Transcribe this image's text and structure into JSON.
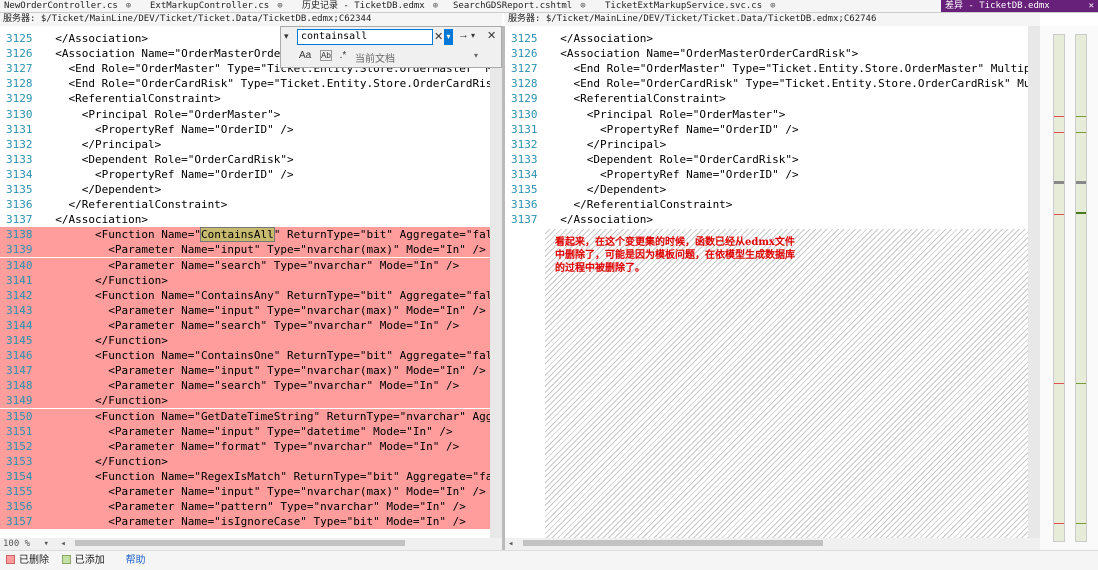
{
  "tabs": [
    {
      "label": "NewOrderController.cs",
      "pin": "⊕"
    },
    {
      "label": "ExtMarkupController.cs",
      "pin": "⊕"
    },
    {
      "label": "历史记录 - TicketDB.edmx",
      "pin": "⊕"
    },
    {
      "label": "SearchGDSReport.cshtml",
      "pin": "⊕"
    },
    {
      "label": "TicketExtMarkupService.svc.cs",
      "pin": "⊕"
    }
  ],
  "active_tab": {
    "label": "差异 - TicketDB.edmx",
    "close": "✕"
  },
  "left_path": "服务器: $/Ticket/MainLine/DEV/Ticket/Ticket.Data/TicketDB.edmx;C62344",
  "right_path": "服务器: $/Ticket/MainLine/DEV/Ticket/Ticket.Data/TicketDB.edmx;C62746",
  "find": {
    "expand": "▾",
    "value": "containsall",
    "clear": "✕",
    "dropdown": "▾",
    "next": "→",
    "next_dropdown": "▾",
    "close": "✕",
    "option_case": "Aa",
    "option_word": "Ab",
    "option_regex": ".*",
    "scope": "当前文档",
    "scope_dropdown": "▾"
  },
  "left_lines": [
    {
      "n": "3125",
      "t": "  </Association>",
      "del": false
    },
    {
      "n": "3126",
      "t": "  <Association Name=\"OrderMasterOrder",
      "del": false
    },
    {
      "n": "3127",
      "t": "    <End Role=\"OrderMaster\" Type=\"Ticket.Entity.Store.OrderMaster\" Multi",
      "del": false
    },
    {
      "n": "3128",
      "t": "    <End Role=\"OrderCardRisk\" Type=\"Ticket.Entity.Store.OrderCardRisk\" M",
      "del": false
    },
    {
      "n": "3129",
      "t": "    <ReferentialConstraint>",
      "del": false
    },
    {
      "n": "3130",
      "t": "      <Principal Role=\"OrderMaster\">",
      "del": false
    },
    {
      "n": "3131",
      "t": "        <PropertyRef Name=\"OrderID\" />",
      "del": false
    },
    {
      "n": "3132",
      "t": "      </Principal>",
      "del": false
    },
    {
      "n": "3133",
      "t": "      <Dependent Role=\"OrderCardRisk\">",
      "del": false
    },
    {
      "n": "3134",
      "t": "        <PropertyRef Name=\"OrderID\" />",
      "del": false
    },
    {
      "n": "3135",
      "t": "      </Dependent>",
      "del": false
    },
    {
      "n": "3136",
      "t": "    </ReferentialConstraint>",
      "del": false
    },
    {
      "n": "3137",
      "t": "  </Association>",
      "del": false
    },
    {
      "n": "3138",
      "pre": "        <Function Name=\"",
      "hl": "ContainsAll",
      "post": "\" ReturnType=\"bit\" Aggregate=\"false\"",
      "del": true
    },
    {
      "n": "3139",
      "t": "          <Parameter Name=\"input\" Type=\"nvarchar(max)\" Mode=\"In\" />",
      "del": true
    },
    {
      "n": "3140",
      "t": "          <Parameter Name=\"search\" Type=\"nvarchar\" Mode=\"In\" />",
      "del": true
    },
    {
      "n": "3141",
      "t": "        </Function>",
      "del": true
    },
    {
      "n": "3142",
      "t": "        <Function Name=\"ContainsAny\" ReturnType=\"bit\" Aggregate=\"false\"",
      "del": true
    },
    {
      "n": "3143",
      "t": "          <Parameter Name=\"input\" Type=\"nvarchar(max)\" Mode=\"In\" />",
      "del": true
    },
    {
      "n": "3144",
      "t": "          <Parameter Name=\"search\" Type=\"nvarchar\" Mode=\"In\" />",
      "del": true
    },
    {
      "n": "3145",
      "t": "        </Function>",
      "del": true
    },
    {
      "n": "3146",
      "t": "        <Function Name=\"ContainsOne\" ReturnType=\"bit\" Aggregate=\"false\"",
      "del": true
    },
    {
      "n": "3147",
      "t": "          <Parameter Name=\"input\" Type=\"nvarchar(max)\" Mode=\"In\" />",
      "del": true
    },
    {
      "n": "3148",
      "t": "          <Parameter Name=\"search\" Type=\"nvarchar\" Mode=\"In\" />",
      "del": true
    },
    {
      "n": "3149",
      "t": "        </Function>",
      "del": true
    },
    {
      "n": "3150",
      "t": "        <Function Name=\"GetDateTimeString\" ReturnType=\"nvarchar\" Aggrega",
      "del": true
    },
    {
      "n": "3151",
      "t": "          <Parameter Name=\"input\" Type=\"datetime\" Mode=\"In\" />",
      "del": true
    },
    {
      "n": "3152",
      "t": "          <Parameter Name=\"format\" Type=\"nvarchar\" Mode=\"In\" />",
      "del": true
    },
    {
      "n": "3153",
      "t": "        </Function>",
      "del": true
    },
    {
      "n": "3154",
      "t": "        <Function Name=\"RegexIsMatch\" ReturnType=\"bit\" Aggregate=\"false\"",
      "del": true
    },
    {
      "n": "3155",
      "t": "          <Parameter Name=\"input\" Type=\"nvarchar(max)\" Mode=\"In\" />",
      "del": true
    },
    {
      "n": "3156",
      "t": "          <Parameter Name=\"pattern\" Type=\"nvarchar\" Mode=\"In\" />",
      "del": true
    },
    {
      "n": "3157",
      "t": "          <Parameter Name=\"isIgnoreCase\" Type=\"bit\" Mode=\"In\" />",
      "del": true
    }
  ],
  "right_lines": [
    {
      "n": "3125",
      "t": "  </Association>"
    },
    {
      "n": "3126",
      "t": "  <Association Name=\"OrderMasterOrderCardRisk\">"
    },
    {
      "n": "3127",
      "t": "    <End Role=\"OrderMaster\" Type=\"Ticket.Entity.Store.OrderMaster\" Multiplic"
    },
    {
      "n": "3128",
      "t": "    <End Role=\"OrderCardRisk\" Type=\"Ticket.Entity.Store.OrderCardRisk\" Multi"
    },
    {
      "n": "3129",
      "t": "    <ReferentialConstraint>"
    },
    {
      "n": "3130",
      "t": "      <Principal Role=\"OrderMaster\">"
    },
    {
      "n": "3131",
      "t": "        <PropertyRef Name=\"OrderID\" />"
    },
    {
      "n": "3132",
      "t": "      </Principal>"
    },
    {
      "n": "3133",
      "t": "      <Dependent Role=\"OrderCardRisk\">"
    },
    {
      "n": "3134",
      "t": "        <PropertyRef Name=\"OrderID\" />"
    },
    {
      "n": "3135",
      "t": "      </Dependent>"
    },
    {
      "n": "3136",
      "t": "    </ReferentialConstraint>"
    },
    {
      "n": "3137",
      "t": "  </Association>"
    }
  ],
  "annotation": "看起来，在这个变更集的时候，函数已经从edmx文件\n中删除了，可能是因为模板问题，在依模型生成数据库\n的过程中被删除了。",
  "zoom": "100 %",
  "legend_deleted": "已删除",
  "legend_added": "已添加",
  "help": "帮助",
  "colors": {
    "deleted": "#ff9c9c",
    "added": "#c5e0a5",
    "accent": "#68217a",
    "line_number": "#2b91af"
  }
}
